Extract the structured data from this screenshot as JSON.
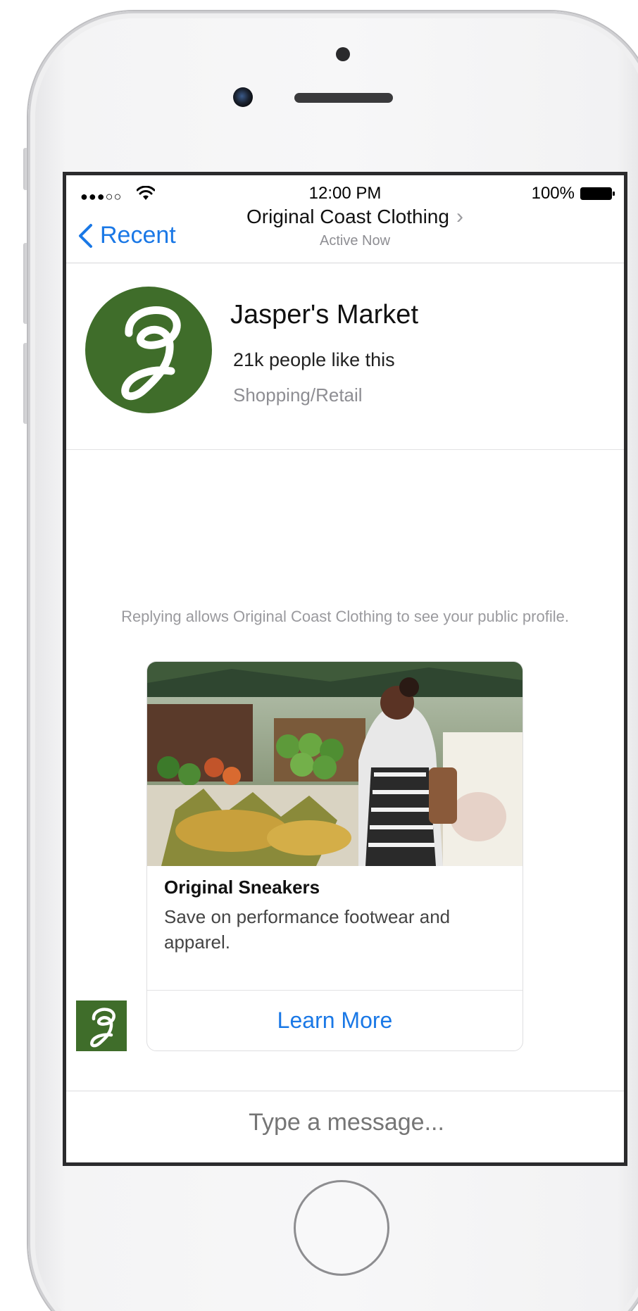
{
  "status_bar": {
    "signal": "●●●○○",
    "time": "12:00 PM",
    "battery": "100%"
  },
  "nav": {
    "back_label": "Recent",
    "title": "Original Coast Clothing",
    "subtitle": "Active Now",
    "chevron": "›"
  },
  "page_header": {
    "name": "Jasper's Market",
    "likes": "21k people like this",
    "category": "Shopping/Retail"
  },
  "thread": {
    "notice": "Replying allows Original Coast Clothing to see your public profile."
  },
  "card": {
    "image_icon": "market-photo",
    "title": "Original Sneakers",
    "description": "Save on performance footwear and apparel.",
    "button_label": "Learn More"
  },
  "composer": {
    "placeholder": "Type a message..."
  },
  "colors": {
    "accent": "#1a78e6",
    "brand_green": "#3f6d2a",
    "muted_text": "#8e8e93"
  },
  "icons": [
    "wifi-icon",
    "battery-icon",
    "back-chevron-icon",
    "title-chevron-icon",
    "jasper-logo-icon"
  ]
}
